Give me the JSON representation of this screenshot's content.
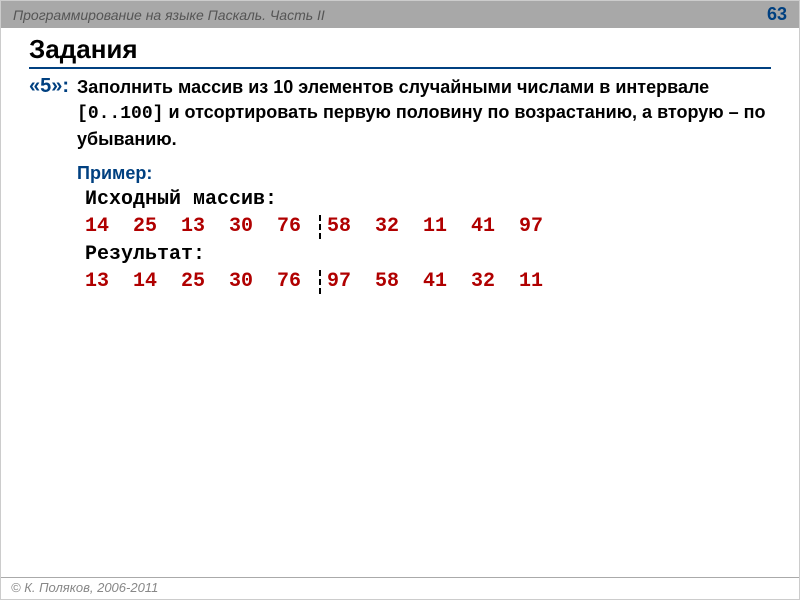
{
  "header": {
    "breadcrumb": "Программирование на языке Паскаль. Часть II",
    "page": "63"
  },
  "title": "Задания",
  "grade": "«5»:",
  "task_text_1": "Заполнить массив из 10 элементов случайными числами в интервале ",
  "task_text_range": "[0..100]",
  "task_text_2": " и отсортировать первую половину по возрастанию, а вторую – по убыванию.",
  "example_label": "Пример:",
  "source_label": "Исходный массив:",
  "result_label": "Результат:",
  "arrays": {
    "source_left": [
      "14",
      "25",
      "13",
      "30",
      "76"
    ],
    "source_right": [
      "58",
      "32",
      "11",
      "41",
      "97"
    ],
    "result_left": [
      "13",
      "14",
      "25",
      "30",
      "76"
    ],
    "result_right": [
      "97",
      "58",
      "41",
      "32",
      "11"
    ]
  },
  "footer": "© К. Поляков, 2006-2011"
}
